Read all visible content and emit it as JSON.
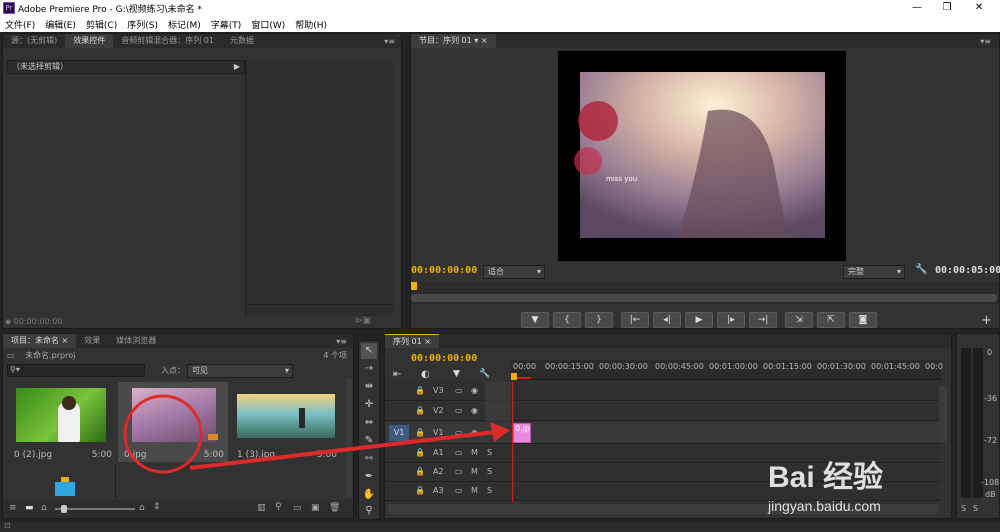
{
  "app": {
    "name_title": "Adobe Premiere Pro - G:\\视频练习\\未命名 *"
  },
  "window_controls": [
    "—",
    "❐",
    "✕"
  ],
  "menu": [
    "文件(F)",
    "编辑(E)",
    "剪辑(C)",
    "序列(S)",
    "标记(M)",
    "字幕(T)",
    "窗口(W)",
    "帮助(H)"
  ],
  "source_panel": {
    "tabs": [
      "源：(无剪辑)",
      "效果控件",
      "音频剪辑混合器：序列 01",
      "元数据"
    ],
    "active_tab": 1,
    "header_label": "（未选择剪辑）",
    "timecode": "00:00:00:00"
  },
  "program_monitor": {
    "tab": "节目：序列 01",
    "timecode_left": "00:00:00:00",
    "fit_label": "适合",
    "quality_label": "完整",
    "timecode_right": "00:00:05:00",
    "frame_text": "miss you",
    "transport": [
      "▼",
      "{",
      "}",
      "|←",
      "◂|",
      "▶",
      "|▸",
      "→|",
      "⇲",
      "⇱",
      "◙"
    ]
  },
  "project_panel": {
    "tabs": [
      "项目：未命名",
      "效果",
      "媒体浏览器"
    ],
    "project_file": "未命名.prproj",
    "item_count": "4 个项",
    "search_placeholder": "",
    "in_point_label": "入点：",
    "in_point_value": "可见",
    "items": [
      {
        "name": "0 (2).jpg",
        "duration": "5:00"
      },
      {
        "name": "0.jpg",
        "duration": "5:00"
      },
      {
        "name": "1 (3).jpg",
        "duration": "5:00"
      }
    ]
  },
  "timeline": {
    "tab": "序列 01",
    "timecode": "00:00:00:00",
    "ruler": [
      "00:00",
      "00:00:15:00",
      "00:00:30:00",
      "00:00:45:00",
      "00:01:00:00",
      "00:01:15:00",
      "00:01:30:00",
      "00:01:45:00",
      "00:0"
    ],
    "video_tracks": [
      "V3",
      "V2",
      "V1"
    ],
    "audio_tracks": [
      "A1",
      "A2",
      "A3"
    ],
    "source_patch": "V1",
    "clip_label": "0.jp",
    "track_mute": "M",
    "track_solo": "S"
  },
  "audio_meter": {
    "ticks": [
      "0",
      "-36",
      "-72",
      "-108"
    ],
    "bottom": [
      "S",
      "S"
    ],
    "db_label": "dB"
  },
  "watermark": {
    "logo": "Bai 经验",
    "url": "jingyan.baidu.com"
  },
  "colors": {
    "accent_timecode": "#f0b000",
    "clip_pink": "#e58ae0",
    "annotation_red": "#e02a2a"
  }
}
